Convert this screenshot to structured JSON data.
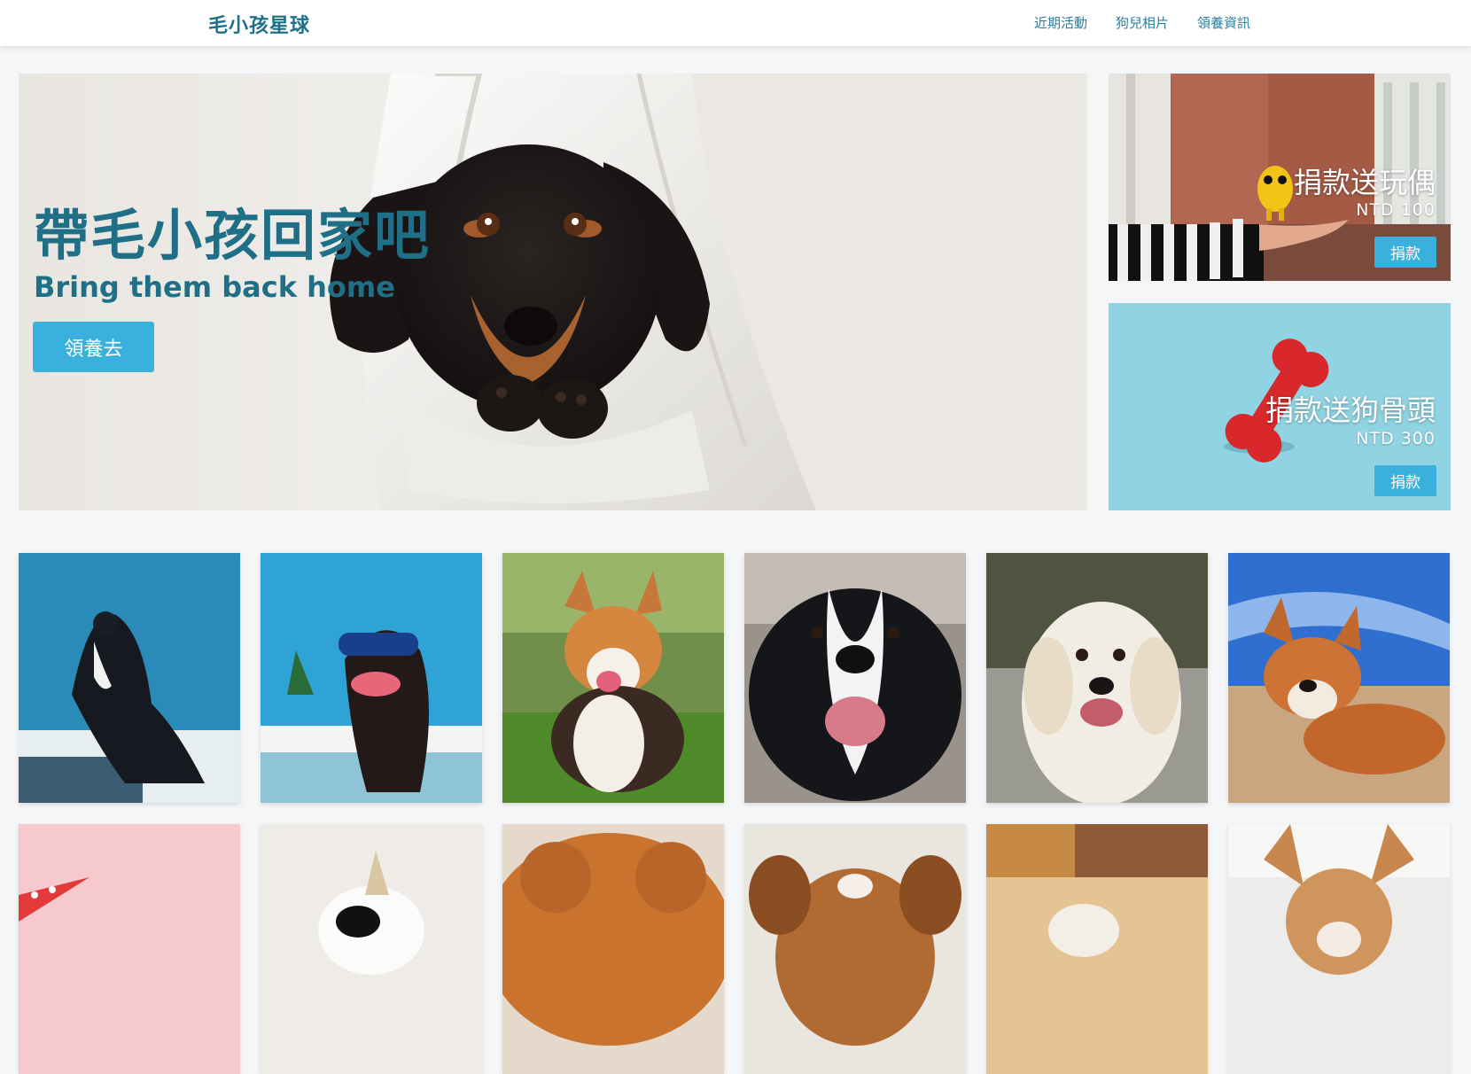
{
  "header": {
    "brand": "毛小孩星球",
    "nav": [
      "近期活動",
      "狗兒相片",
      "領養資訊"
    ]
  },
  "hero": {
    "title": "帶毛小孩回家吧",
    "subtitle": "Bring them back home",
    "button_label": "領養去"
  },
  "promos": [
    {
      "title": "捐款送玩偶",
      "price": "NTD 100",
      "button_label": "捐款"
    },
    {
      "title": "捐款送狗骨頭",
      "price": "NTD 300",
      "button_label": "捐款"
    }
  ],
  "gallery": {
    "photos": [
      {
        "name": "border-collie-snow"
      },
      {
        "name": "dachshund-sunglasses"
      },
      {
        "name": "corgi-grass"
      },
      {
        "name": "border-collie-closeup"
      },
      {
        "name": "golden-retriever"
      },
      {
        "name": "corgi-beach"
      },
      {
        "name": "pink-background"
      },
      {
        "name": "unicorn-costume"
      },
      {
        "name": "chow-chow"
      },
      {
        "name": "brown-puppy"
      },
      {
        "name": "dog-with-shelf"
      },
      {
        "name": "chihuahua"
      }
    ]
  },
  "colors": {
    "brand": "#1f6f87",
    "nav_link": "#2a7f9e",
    "button": "#39b1dc",
    "background": "#f4f6f8"
  }
}
